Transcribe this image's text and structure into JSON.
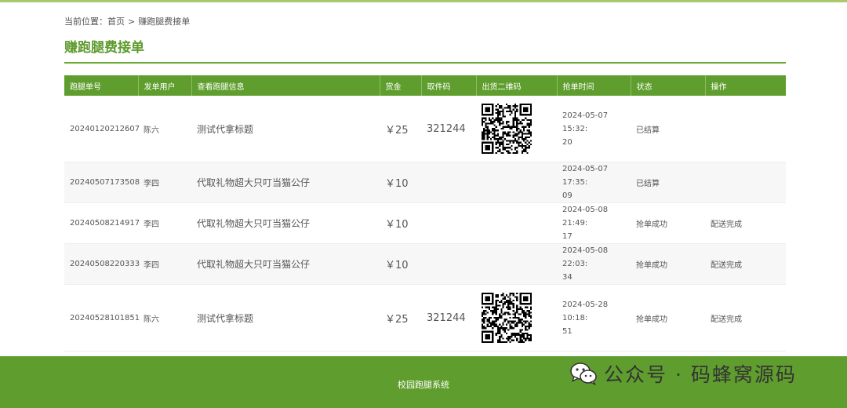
{
  "breadcrumb": {
    "prefix": "当前位置：",
    "home": "首页",
    "separator": ">",
    "current": "赚跑腿费接单"
  },
  "page": {
    "title": "赚跑腿费接单"
  },
  "table": {
    "headers": [
      "跑腿单号",
      "发单用户",
      "查看跑腿信息",
      "赏金",
      "取件码",
      "出货二维码",
      "抢单时间",
      "状态",
      "操作"
    ],
    "rows": [
      {
        "id": "20240120212607",
        "user": "陈六",
        "info": "测试代拿标题",
        "reward": "￥25",
        "code": "321244",
        "has_qr": true,
        "time_line1": "2024-05-07 15:32:",
        "time_line2": "20",
        "status": "已结算",
        "action": ""
      },
      {
        "id": "20240507173508",
        "user": "李四",
        "info": "代取礼物超大只叮当猫公仔",
        "reward": "￥10",
        "code": "",
        "has_qr": false,
        "time_line1": "2024-05-07 17:35:",
        "time_line2": "09",
        "status": "已结算",
        "action": ""
      },
      {
        "id": "20240508214917",
        "user": "李四",
        "info": "代取礼物超大只叮当猫公仔",
        "reward": "￥10",
        "code": "",
        "has_qr": false,
        "time_line1": "2024-05-08 21:49:",
        "time_line2": "17",
        "status": "抢单成功",
        "action": "配送完成"
      },
      {
        "id": "20240508220333",
        "user": "李四",
        "info": "代取礼物超大只叮当猫公仔",
        "reward": "￥10",
        "code": "",
        "has_qr": false,
        "time_line1": "2024-05-08 22:03:",
        "time_line2": "34",
        "status": "抢单成功",
        "action": "配送完成"
      },
      {
        "id": "20240528101851",
        "user": "陈六",
        "info": "测试代拿标题",
        "reward": "￥25",
        "code": "321244",
        "has_qr": true,
        "time_line1": "2024-05-28 10:18:",
        "time_line2": "51",
        "status": "抢单成功",
        "action": "配送完成"
      }
    ]
  },
  "footer": {
    "text": "校园跑腿系统"
  },
  "watermark": {
    "text": "公众号 · 码蜂窝源码",
    "icon": "wechat-icon"
  },
  "colors": {
    "primary_green": "#5f9e2e",
    "accent_red": "#e02020",
    "top_line": "#a9c96a"
  }
}
